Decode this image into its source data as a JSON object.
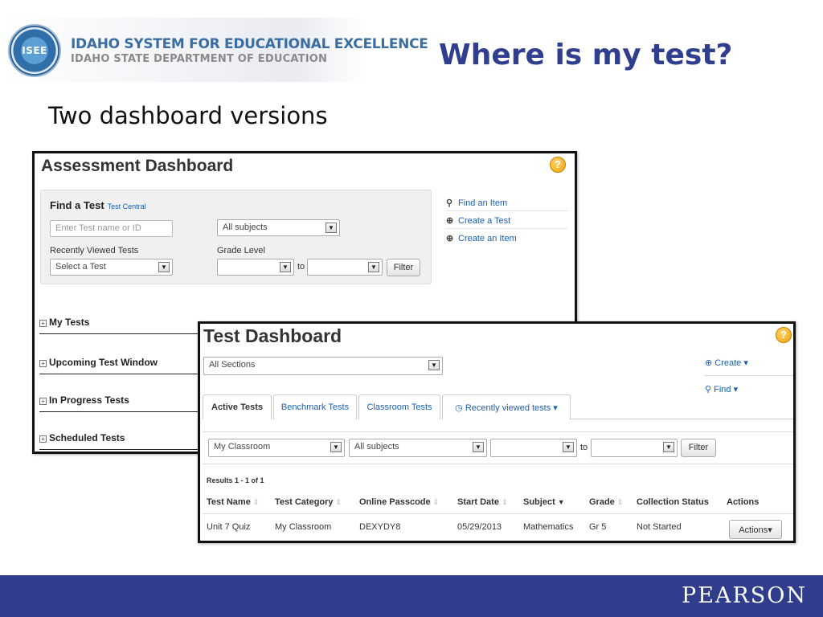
{
  "slide": {
    "org_name": "IDAHO SYSTEM FOR EDUCATIONAL EXCELLENCE",
    "org_dept": "IDAHO STATE DEPARTMENT OF EDUCATION",
    "seal_text": "ISEE",
    "title": "Where is my test?",
    "subtitle": "Two dashboard versions",
    "footer_brand": "PEARSON",
    "footer_color": "#2f3d8c",
    "title_color": "#2f3e8e"
  },
  "assessment_dashboard": {
    "title": "Assessment Dashboard",
    "help_icon": "?",
    "find_a_test": {
      "heading": "Find a Test",
      "heading_link": "Test Central",
      "name_placeholder": "Enter Test name or ID",
      "subject_value": "All subjects",
      "recent_label": "Recently Viewed Tests",
      "recent_value": "Select a Test",
      "grade_label": "Grade Level",
      "grade_from": "",
      "to_label": "to",
      "grade_to": "",
      "filter_label": "Filter"
    },
    "side_links": [
      {
        "icon": "search-icon",
        "label": "Find an Item"
      },
      {
        "icon": "plus-circle-icon",
        "label": "Create a Test"
      },
      {
        "icon": "plus-circle-icon",
        "label": "Create an Item"
      }
    ],
    "sections": [
      "My Tests",
      "Upcoming Test Window",
      "In Progress Tests",
      "Scheduled Tests"
    ]
  },
  "test_dashboard": {
    "title": "Test Dashboard",
    "help_icon": "?",
    "section_select": "All Sections",
    "create_label": "Create",
    "find_label": "Find",
    "tabs": [
      {
        "label": "Active Tests",
        "active": true
      },
      {
        "label": "Benchmark Tests",
        "active": false
      },
      {
        "label": "Classroom Tests",
        "active": false
      },
      {
        "label": "Recently viewed tests",
        "active": false
      }
    ],
    "filters": {
      "category": "My Classroom",
      "subject": "All subjects",
      "grade_from": "",
      "to_label": "to",
      "grade_to": "",
      "filter_label": "Filter"
    },
    "results_text": "Results 1 - 1 of 1",
    "columns": [
      "Test Name",
      "Test Category",
      "Online Passcode",
      "Start Date",
      "Subject",
      "Grade",
      "Collection Status",
      "Actions"
    ],
    "rows": [
      {
        "test_name": "Unit 7 Quiz",
        "category": "My Classroom",
        "passcode": "DEXYDY8",
        "start_date": "05/29/2013",
        "subject": "Mathematics",
        "grade": "Gr 5",
        "status": "Not Started",
        "actions_label": "Actions"
      }
    ]
  }
}
